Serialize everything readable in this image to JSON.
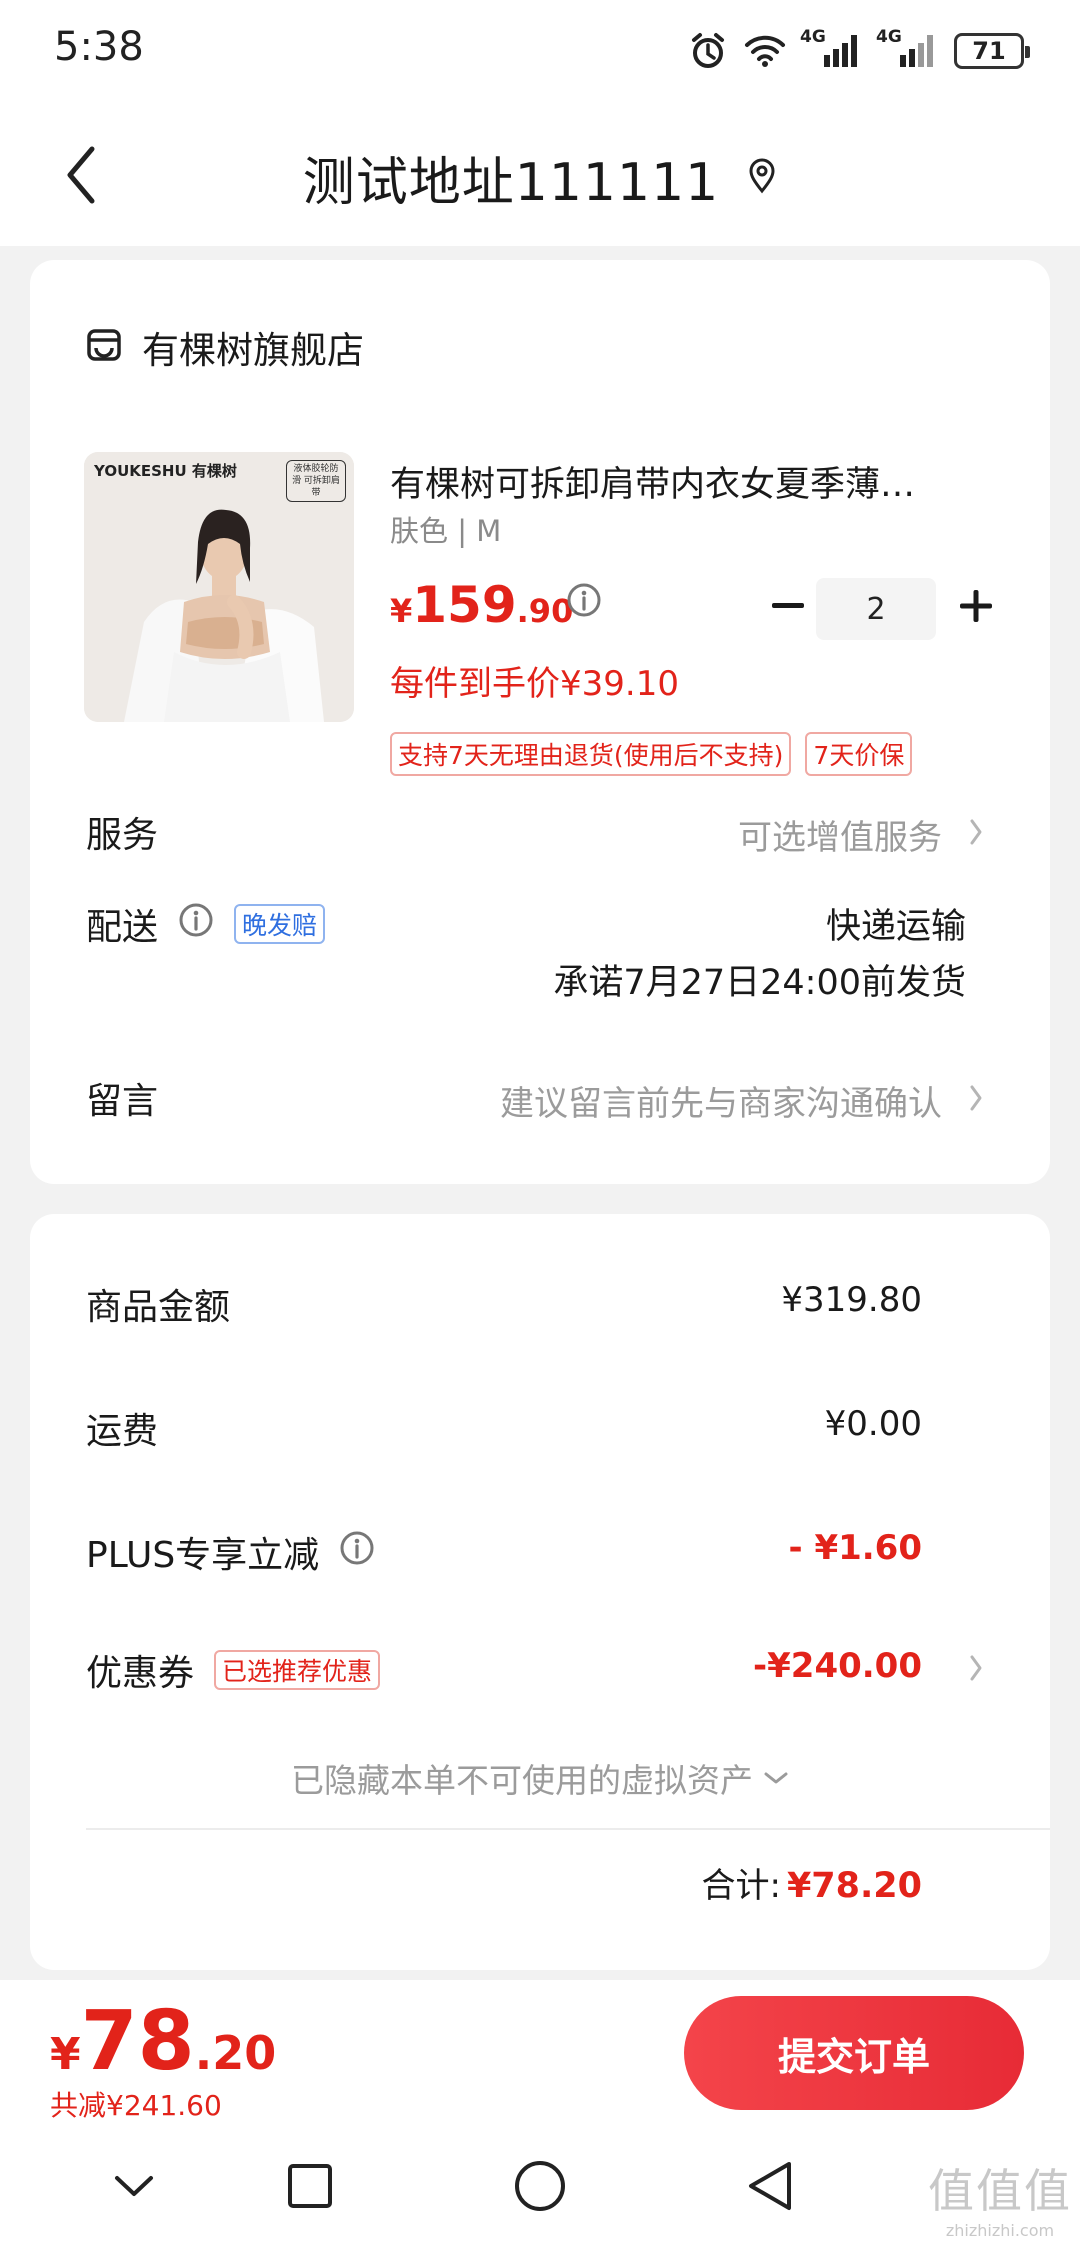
{
  "status_bar": {
    "time": "5:38",
    "network_1": "4G",
    "network_2": "4G",
    "battery": "71"
  },
  "header": {
    "title": "测试地址111111"
  },
  "store": {
    "name": "有棵树旗舰店"
  },
  "product": {
    "image_brand_text": "YOUKESHU 有棵树",
    "image_badge_text": "液体胶轮防滑 可拆卸肩带",
    "title": "有棵树可拆卸肩带内衣女夏季薄…",
    "spec": "肤色 | M",
    "price_symbol": "¥",
    "price_int": "159",
    "price_dec": ".90",
    "quantity": "2",
    "unit_price": "每件到手价¥39.10",
    "tags": [
      "支持7天无理由退货(使用后不支持)",
      "7天价保"
    ]
  },
  "service": {
    "label": "服务",
    "value": "可选增值服务"
  },
  "delivery": {
    "label": "配送",
    "badge": "晚发赔",
    "method": "快递运输",
    "promise": "承诺7月27日24:00前发货"
  },
  "message": {
    "label": "留言",
    "placeholder": "建议留言前先与商家沟通确认"
  },
  "summary": {
    "goods_label": "商品金额",
    "goods_value": "¥319.80",
    "shipping_label": "运费",
    "shipping_value": "¥0.00",
    "plus_label": "PLUS专享立减",
    "plus_value": "- ¥1.60",
    "coupon_label": "优惠券",
    "coupon_badge": "已选推荐优惠",
    "coupon_value": "-¥240.00",
    "hidden_assets": "已隐藏本单不可使用的虚拟资产",
    "total_label": "合计:",
    "total_value": "¥78.20"
  },
  "bottom": {
    "price_symbol": "¥",
    "price_int": "78",
    "price_dec": ".20",
    "saved": "共减¥241.60",
    "submit_label": "提交订单"
  },
  "watermark": {
    "logo": "值值值",
    "url": "zhizhizhi.com"
  },
  "colors": {
    "accent_red": "#e2231a",
    "badge_blue": "#2f6fe0",
    "submit_gradient_start": "#f4444a",
    "submit_gradient_end": "#e72b36"
  },
  "icons": [
    "alarm-icon",
    "wifi-icon",
    "signal-icon",
    "battery-icon",
    "back-icon",
    "location-pin-icon",
    "store-icon",
    "info-icon",
    "minus-icon",
    "plus-icon",
    "chevron-right-icon",
    "chevron-down-icon",
    "nav-down-icon",
    "nav-square-icon",
    "nav-circle-icon",
    "nav-back-icon"
  ]
}
